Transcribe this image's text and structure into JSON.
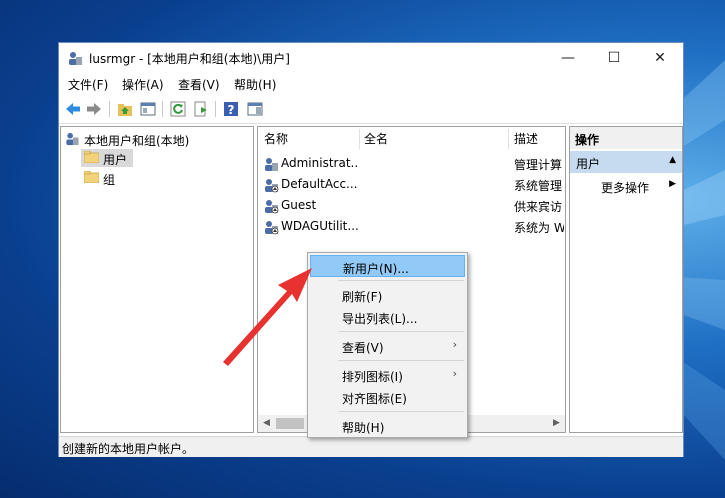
{
  "window": {
    "title": "lusrmgr - [本地用户和组(本地)\\用户]",
    "minimize_glyph": "—",
    "maximize_glyph": "☐",
    "close_glyph": "✕"
  },
  "menubar": {
    "items": [
      "文件(F)",
      "操作(A)",
      "查看(V)",
      "帮助(H)"
    ]
  },
  "toolbar": {
    "icons": [
      "back-icon",
      "forward-icon",
      "up-folder-icon",
      "show-hide-tree-icon",
      "refresh-icon",
      "export-list-icon",
      "help-icon",
      "action-pane-icon"
    ]
  },
  "tree": {
    "root": "本地用户和组(本地)",
    "children": [
      {
        "label": "用户",
        "selected": true
      },
      {
        "label": "组",
        "selected": false
      }
    ]
  },
  "list": {
    "columns": [
      "名称",
      "全名",
      "描述"
    ],
    "rows": [
      {
        "name": "Administrat...",
        "fullname": "",
        "desc": "管理计算"
      },
      {
        "name": "DefaultAcc...",
        "fullname": "",
        "desc": "系统管理"
      },
      {
        "name": "Guest",
        "fullname": "",
        "desc": "供来宾访"
      },
      {
        "name": "WDAGUtilit...",
        "fullname": "",
        "desc": "系统为 W"
      }
    ]
  },
  "actions_pane": {
    "header": "操作",
    "section": "用户",
    "section_glyph": "▲",
    "more": "更多操作",
    "more_glyph": "▶"
  },
  "statusbar": {
    "text": "创建新的本地用户帐户。"
  },
  "context_menu": {
    "items": [
      {
        "label": "新用户(N)...",
        "submenu": "",
        "highlighted": true
      },
      {
        "label": "刷新(F)",
        "submenu": ""
      },
      {
        "label": "导出列表(L)...",
        "submenu": ""
      },
      {
        "label": "查看(V)",
        "submenu": "›"
      },
      {
        "label": "排列图标(I)",
        "submenu": "›"
      },
      {
        "label": "对齐图标(E)",
        "submenu": ""
      },
      {
        "label": "帮助(H)",
        "submenu": ""
      }
    ]
  },
  "colors": {
    "highlight": "#91c9f7",
    "annotation_arrow": "#e8322f",
    "selection": "#cce8ff"
  }
}
